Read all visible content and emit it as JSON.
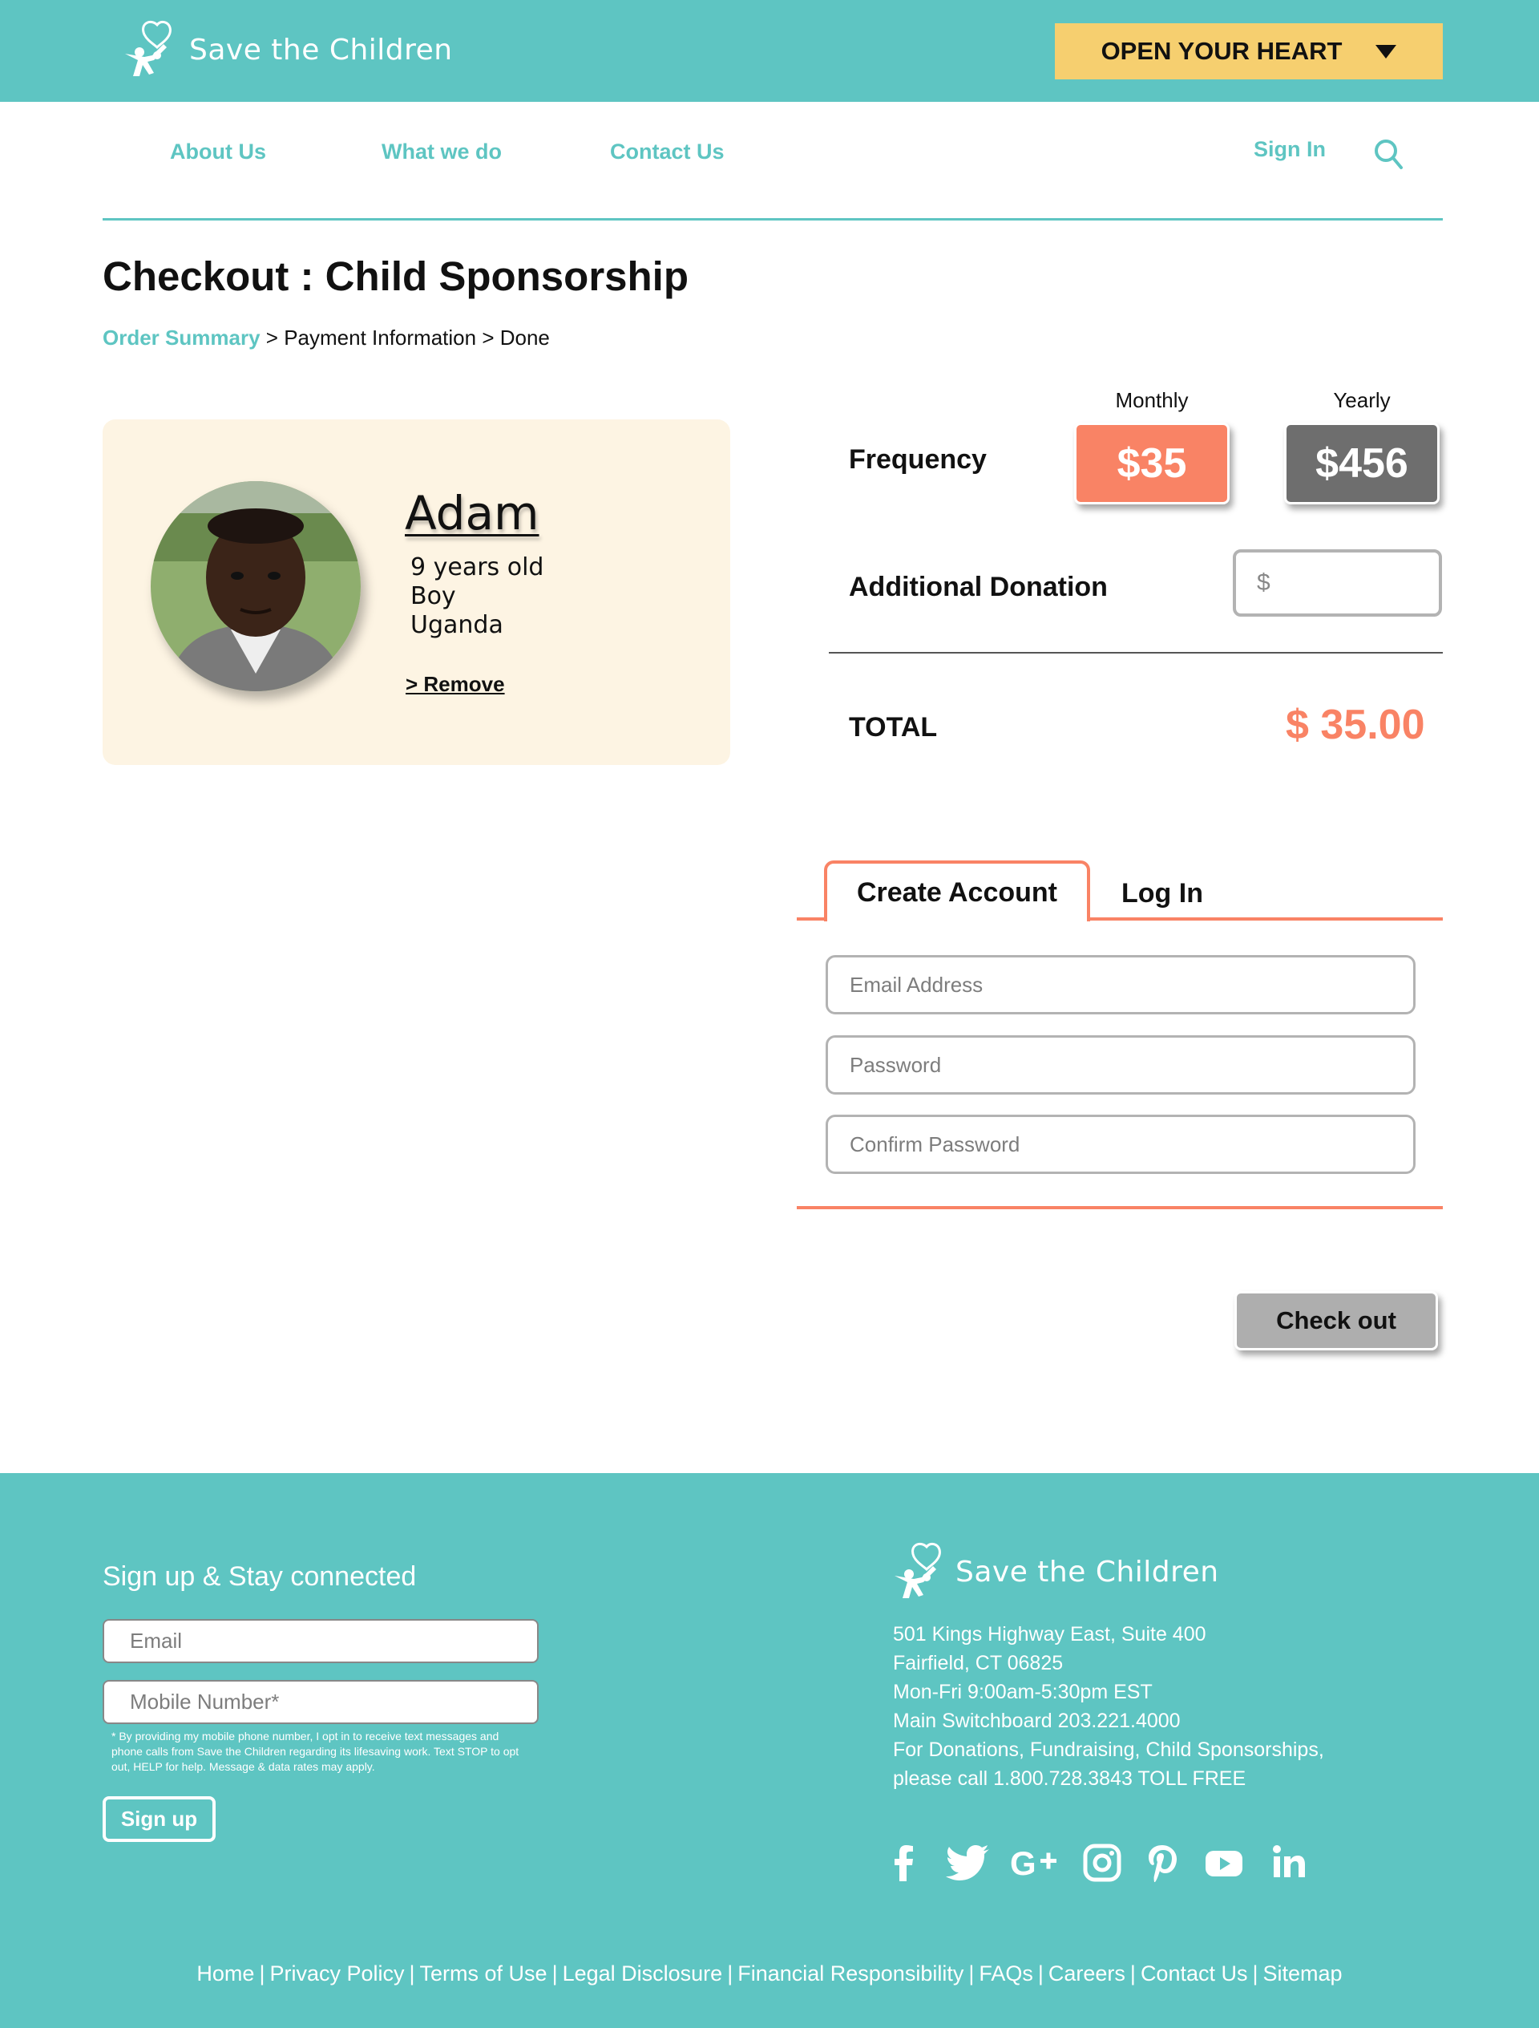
{
  "brand": {
    "name": "Save the Children"
  },
  "header": {
    "cta_label": "OPEN YOUR HEART"
  },
  "nav": {
    "items": [
      {
        "label": "About Us"
      },
      {
        "label": "What we do"
      },
      {
        "label": "Contact Us"
      }
    ],
    "sign_in": "Sign In"
  },
  "page": {
    "title": "Checkout : Child Sponsorship"
  },
  "breadcrumb": {
    "step1": "Order Summary",
    "step2": "Payment Information",
    "step3": "Done",
    "separator": ">"
  },
  "child": {
    "name": "Adam",
    "age": "9 years old",
    "gender": "Boy",
    "country": "Uganda",
    "remove_label": "> Remove"
  },
  "frequency": {
    "label": "Frequency",
    "options": [
      {
        "heading": "Monthly",
        "price": "$35",
        "selected": true
      },
      {
        "heading": "Yearly",
        "price": "$456",
        "selected": false
      }
    ]
  },
  "donation": {
    "label": "Additional Donation",
    "currency_symbol": "$",
    "value": ""
  },
  "total": {
    "label": "TOTAL",
    "value": "$ 35.00"
  },
  "account": {
    "tabs": [
      {
        "label": "Create Account",
        "active": true
      },
      {
        "label": "Log In",
        "active": false
      }
    ],
    "email_placeholder": "Email Address",
    "password_placeholder": "Password",
    "confirm_placeholder": "Confirm Password"
  },
  "checkout_label": "Check out",
  "footer": {
    "heading": "Sign up & Stay connected",
    "email_placeholder": "Email",
    "mobile_placeholder": "Mobile Number*",
    "disclaimer": "* By providing my mobile phone number, I opt in to receive text messages and phone calls from Save the Children regarding its lifesaving work. Text STOP to opt out, HELP for help. Message & data rates may apply.",
    "signup_label": "Sign up",
    "address": [
      "501 Kings Highway East, Suite 400",
      "Fairfield, CT 06825",
      "Mon-Fri 9:00am-5:30pm EST",
      "Main Switchboard 203.221.4000",
      "For Donations, Fundraising, Child Sponsorships,",
      "please call 1.800.728.3843 TOLL FREE"
    ],
    "social_icons": [
      "facebook-icon",
      "twitter-icon",
      "google-plus-icon",
      "instagram-icon",
      "pinterest-icon",
      "youtube-icon",
      "linkedin-icon"
    ],
    "links": [
      "Home",
      "Privacy Policy",
      "Terms of Use",
      "Legal Disclosure",
      "Financial Responsibility",
      "FAQs",
      "Careers",
      "Contact Us",
      "Sitemap"
    ]
  },
  "colors": {
    "teal": "#5ec5c2",
    "coral": "#f98365",
    "yellow": "#f6cf6f",
    "cream": "#fdf4e3",
    "gray": "#6e6e6e"
  }
}
